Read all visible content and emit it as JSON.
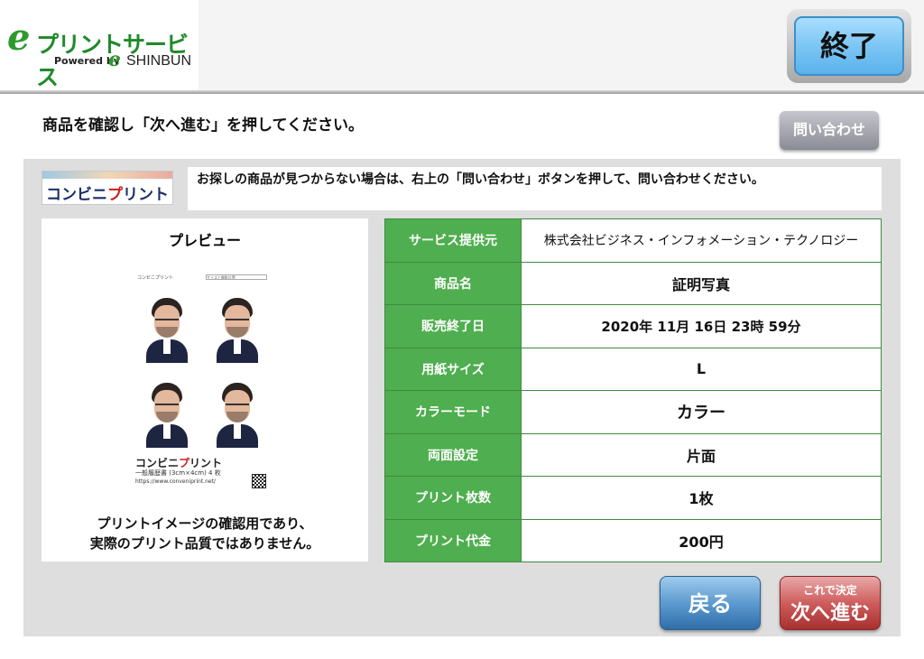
{
  "header": {
    "logo_e": "e",
    "logo_title": "プリントサービス",
    "logo_powered": "Powered by",
    "logo_e2": "e",
    "logo_brand": "SHINBUN",
    "end_label": "終了"
  },
  "instruction": "商品を確認し「次へ進む」を押してください。",
  "contact_label": "問い合わせ",
  "service_logo": {
    "text_a": "コンビニ",
    "text_red": "プ",
    "text_b": "リント"
  },
  "notice": "お探しの商品が見つからない場合は、右上の「問い合わせ」ボタンを押して、問い合わせください。",
  "preview": {
    "title": "プレビュー",
    "sheet_head1": "コンビニプリント",
    "sheet_head2": "サイズと撮影位置",
    "brand_a": "コンビニ",
    "brand_red": "プ",
    "brand_b": "リント",
    "spec": "一般履歴書 (3cm×4cm) 4 枚",
    "url": "https://www.conveniprint.net/",
    "note_line1": "プリントイメージの確認用であり、",
    "note_line2": "実際のプリント品質ではありません。"
  },
  "details": [
    {
      "key": "サービス提供元",
      "value": "株式会社ビジネス・インフォメーション・テクノロジー"
    },
    {
      "key": "商品名",
      "value": "証明写真"
    },
    {
      "key": "販売終了日",
      "value": "2020年 11月 16日 23時 59分"
    },
    {
      "key": "用紙サイズ",
      "value": "L"
    },
    {
      "key": "カラーモード",
      "value": "カラー"
    },
    {
      "key": "両面設定",
      "value": "片面"
    },
    {
      "key": "プリント枚数",
      "value": "1枚"
    },
    {
      "key": "プリント代金",
      "value": "200円"
    }
  ],
  "buttons": {
    "back_label": "戻る",
    "next_sub": "これで決定",
    "next_main": "次へ進む"
  },
  "colors": {
    "table_key_bg": "#4fae4f",
    "end_button": "#7cc6f4",
    "back_button": "#5d9bd0",
    "next_button": "#cf5d5d",
    "panel_bg": "#dedede"
  }
}
